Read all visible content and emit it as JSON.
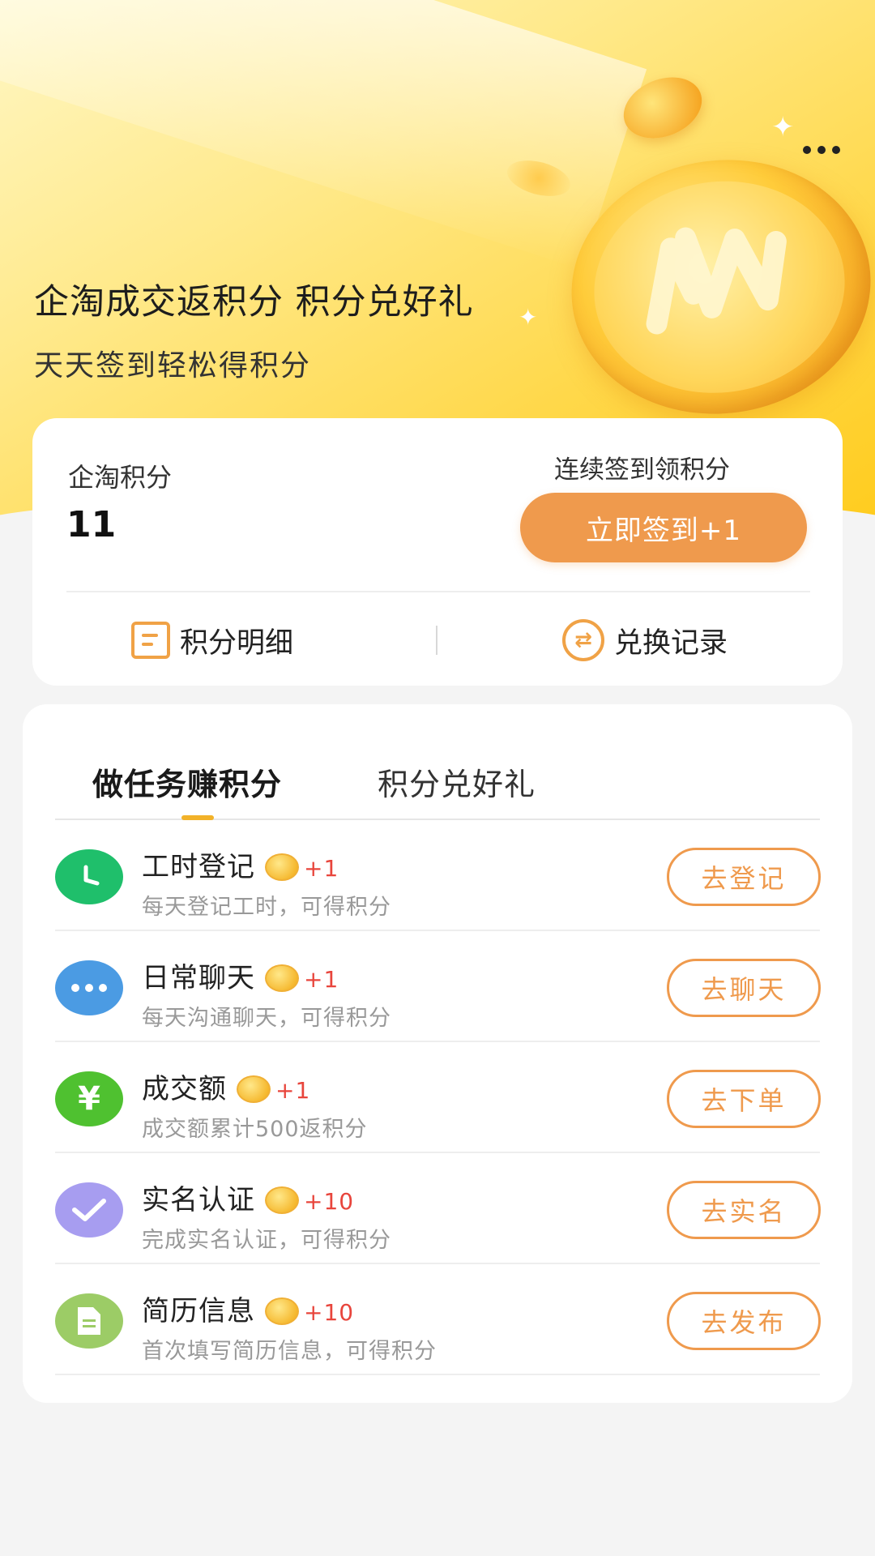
{
  "hero": {
    "title": "企淘成交返积分 积分兑好礼",
    "subtitle": "天天签到轻松得积分"
  },
  "points_card": {
    "label": "企淘积分",
    "value": "11",
    "signin_hint": "连续签到领积分",
    "signin_button": "立即签到+1",
    "detail_link": "积分明细",
    "records_link": "兑换记录"
  },
  "tabs": [
    {
      "label": "做任务赚积分",
      "active": true
    },
    {
      "label": "积分兑好礼",
      "active": false
    }
  ],
  "tasks": [
    {
      "title": "工时登记",
      "reward": "+1",
      "desc": "每天登记工时，可得积分",
      "button": "去登记",
      "icon": "clock-icon",
      "color": "#1fbf6b"
    },
    {
      "title": "日常聊天",
      "reward": "+1",
      "desc": "每天沟通聊天，可得积分",
      "button": "去聊天",
      "icon": "chat-icon",
      "color": "#4b9be3"
    },
    {
      "title": "成交额",
      "reward": "+1",
      "desc": "成交额累计500返积分",
      "button": "去下单",
      "icon": "yuan-icon",
      "color": "#4fc130"
    },
    {
      "title": "实名认证",
      "reward": "+10",
      "desc": "完成实名认证，可得积分",
      "button": "去实名",
      "icon": "check-icon",
      "color": "#a79df0"
    },
    {
      "title": "简历信息",
      "reward": "+10",
      "desc": "首次填写简历信息，可得积分",
      "button": "去发布",
      "icon": "document-icon",
      "color": "#9ccc66"
    }
  ],
  "colors": {
    "accent": "#ef9a4d",
    "reward": "#e8453c",
    "tab_indicator": "#f2b229"
  }
}
